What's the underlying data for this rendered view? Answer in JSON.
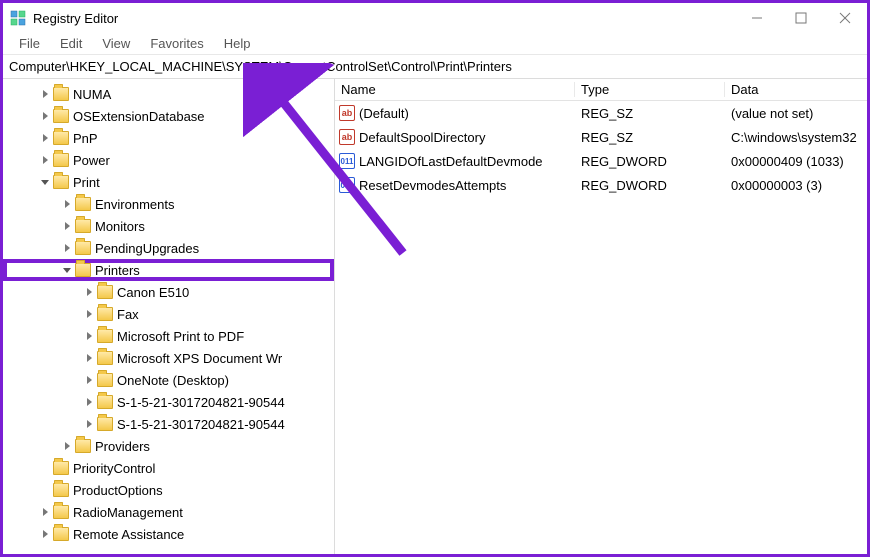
{
  "window": {
    "title": "Registry Editor"
  },
  "menu": {
    "file": "File",
    "edit": "Edit",
    "view": "View",
    "favorites": "Favorites",
    "help": "Help"
  },
  "address": "Computer\\HKEY_LOCAL_MACHINE\\SYSTEM\\CurrentControlSet\\Control\\Print\\Printers",
  "tree": {
    "numa": "NUMA",
    "osext": "OSExtensionDatabase",
    "pnp": "PnP",
    "power": "Power",
    "print": "Print",
    "environments": "Environments",
    "monitors": "Monitors",
    "pendingupgrades": "PendingUpgrades",
    "printers": "Printers",
    "canon": "Canon E510",
    "fax": "Fax",
    "mspdf": "Microsoft Print to PDF",
    "msxps": "Microsoft XPS Document Wr",
    "onenote": "OneNote (Desktop)",
    "sid1": "S-1-5-21-3017204821-90544",
    "sid2": "S-1-5-21-3017204821-90544",
    "providers": "Providers",
    "prioritycontrol": "PriorityControl",
    "productoptions": "ProductOptions",
    "radiomanagement": "RadioManagement",
    "remoteassistance": "Remote Assistance"
  },
  "listheaders": {
    "name": "Name",
    "type": "Type",
    "data": "Data"
  },
  "values": [
    {
      "icon": "str",
      "name": "(Default)",
      "type": "REG_SZ",
      "data": "(value not set)"
    },
    {
      "icon": "str",
      "name": "DefaultSpoolDirectory",
      "type": "REG_SZ",
      "data": "C:\\windows\\system32"
    },
    {
      "icon": "bin",
      "name": "LANGIDOfLastDefaultDevmode",
      "type": "REG_DWORD",
      "data": "0x00000409 (1033)"
    },
    {
      "icon": "bin",
      "name": "ResetDevmodesAttempts",
      "type": "REG_DWORD",
      "data": "0x00000003 (3)"
    }
  ]
}
